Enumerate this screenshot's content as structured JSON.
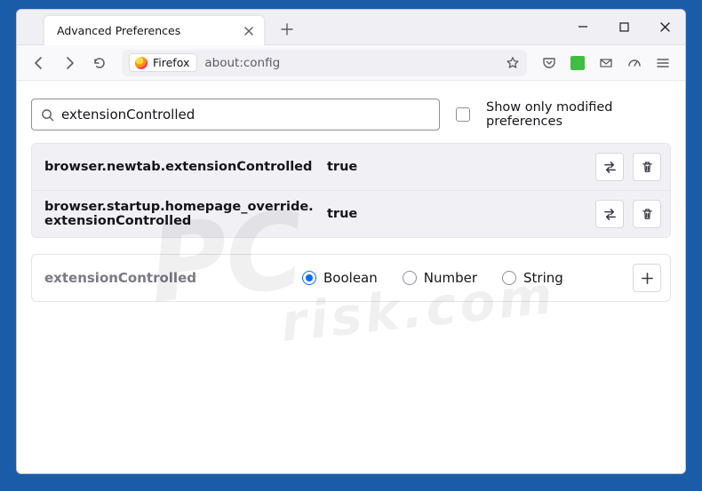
{
  "titlebar": {
    "tab_title": "Advanced Preferences"
  },
  "urlbar": {
    "identity_label": "Firefox",
    "url": "about:config"
  },
  "search": {
    "value": "extensionControlled",
    "toggle_label": "Show only modified preferences"
  },
  "prefs": [
    {
      "name": "browser.newtab.extensionControlled",
      "value": "true"
    },
    {
      "name": "browser.startup.homepage_override.extensionControlled",
      "value": "true"
    }
  ],
  "new_pref": {
    "name": "extensionControlled",
    "types": [
      "Boolean",
      "Number",
      "String"
    ],
    "selected_type": "Boolean"
  },
  "icons": {
    "close": "close-icon",
    "newtab": "plus-icon",
    "min": "minimize-icon",
    "max": "maximize-icon",
    "winclose": "close-window-icon",
    "back": "back-icon",
    "forward": "forward-icon",
    "reload": "reload-icon",
    "star": "bookmark-star-icon",
    "pocket": "pocket-icon",
    "ext": "extension-icon",
    "mail": "mail-icon",
    "shield": "dashboard-icon",
    "menu": "hamburger-menu-icon",
    "search": "search-icon",
    "toggle": "swap-icon",
    "delete": "trash-icon",
    "add": "plus-icon"
  },
  "watermark": {
    "l1": "PC",
    "l2": "risk.com"
  }
}
